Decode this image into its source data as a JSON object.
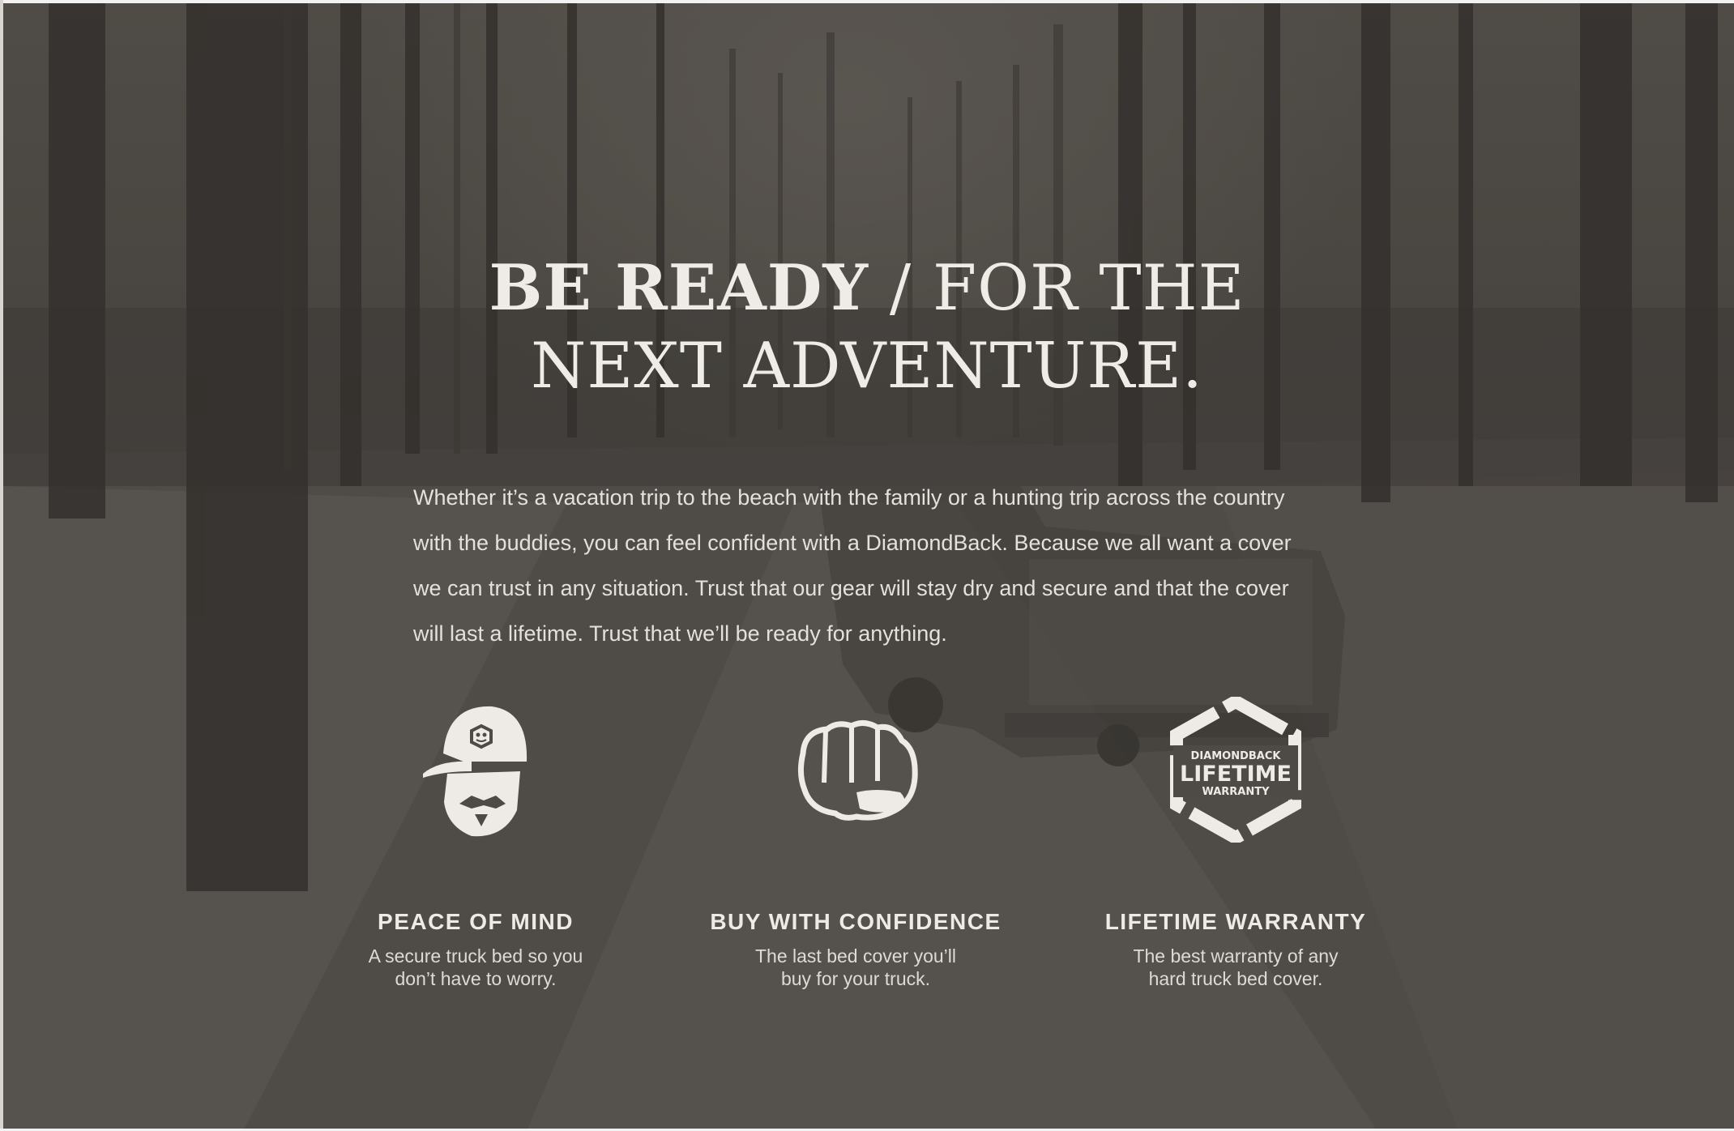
{
  "headline": {
    "bold": "BE READY",
    "light_line1": " / FOR THE",
    "line2": "NEXT ADVENTURE."
  },
  "body_text": "Whether it’s a vacation trip to the beach with the family or a hunting trip across the country with the buddies, you can feel confident with a DiamondBack. Because we all want a cover we can trust in any situation. Trust that our gear will stay dry and secure and that the cover will last a lifetime. Trust that we’ll be ready for anything.",
  "features": [
    {
      "icon": "bearded-man-cap-icon",
      "title": "PEACE OF MIND",
      "desc_line1": "A secure truck bed so you",
      "desc_line2": "don’t have to worry."
    },
    {
      "icon": "fist-icon",
      "title": "BUY WITH CONFIDENCE",
      "desc_line1": "The last bed cover you’ll",
      "desc_line2": "buy for your truck."
    },
    {
      "icon": "lifetime-warranty-badge-icon",
      "title": "LIFETIME WARRANTY",
      "desc_line1": "The best warranty of any",
      "desc_line2": "hard truck bed cover.",
      "badge_top": "DIAMONDBACK",
      "badge_middle": "LIFETIME",
      "badge_bottom": "WARRANTY"
    }
  ],
  "colors": {
    "text": "#efece8",
    "background": "#4e4a46"
  }
}
